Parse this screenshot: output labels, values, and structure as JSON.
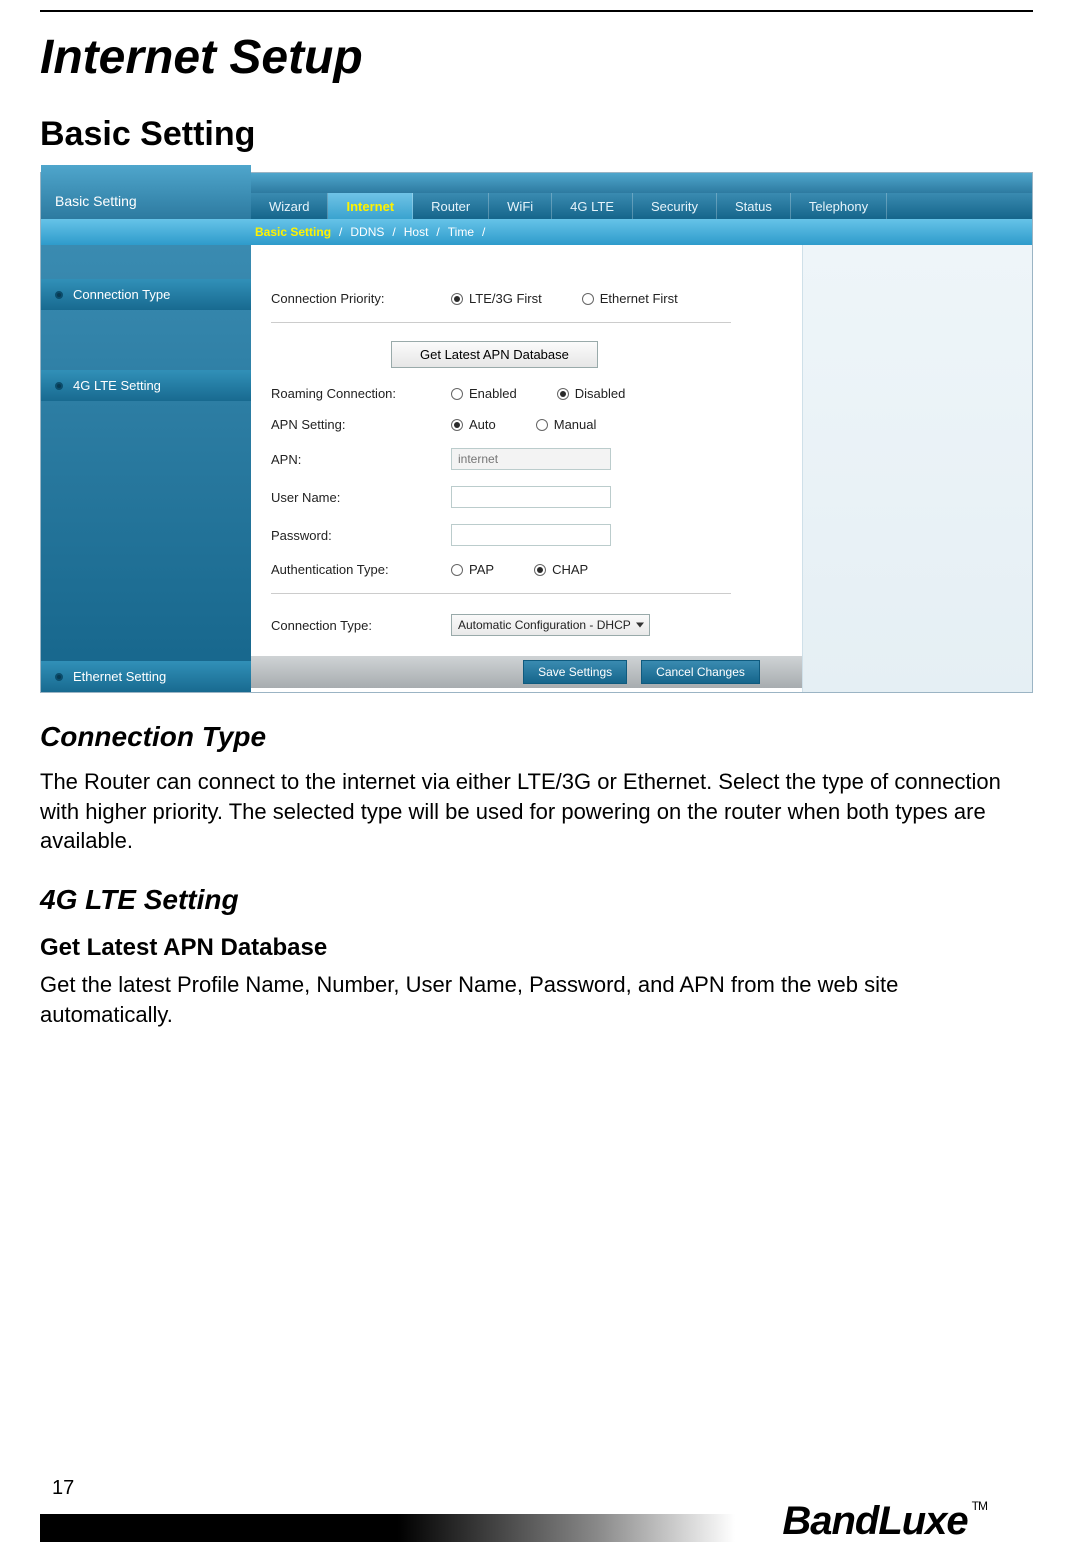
{
  "page": {
    "title": "Internet Setup",
    "section": "Basic Setting",
    "connection_type_heading": "Connection Type",
    "connection_type_body": "The Router can connect to the internet via either LTE/3G or Ethernet. Select the type of connection with higher priority. The selected type will be used for powering on the router when both types are available.",
    "lte_heading": "4G LTE Setting",
    "apn_db_heading": "Get Latest APN Database",
    "apn_db_body": "Get the latest Profile Name, Number, User Name, Password, and APN from the web site automatically.",
    "page_number": "17",
    "brand": "BandLuxe",
    "brand_tm": "TM"
  },
  "screenshot": {
    "sidebar_title": "Basic Setting",
    "tabs": [
      "Wizard",
      "Internet",
      "Router",
      "WiFi",
      "4G LTE",
      "Security",
      "Status",
      "Telephony"
    ],
    "active_tab_index": 1,
    "subnav": [
      "Basic Setting",
      "DDNS",
      "Host",
      "Time"
    ],
    "subnav_active_index": 0,
    "side_items": [
      "Connection Type",
      "4G LTE Setting",
      "Ethernet Setting"
    ],
    "conn_priority_label": "Connection Priority:",
    "conn_priority_opts": [
      "LTE/3G First",
      "Ethernet First"
    ],
    "conn_priority_selected": 0,
    "get_apn_btn": "Get Latest APN Database",
    "roaming_label": "Roaming Connection:",
    "roaming_opts": [
      "Enabled",
      "Disabled"
    ],
    "roaming_selected": 1,
    "apn_setting_label": "APN Setting:",
    "apn_setting_opts": [
      "Auto",
      "Manual"
    ],
    "apn_setting_selected": 0,
    "apn_label": "APN:",
    "apn_placeholder": "internet",
    "username_label": "User Name:",
    "password_label": "Password:",
    "auth_label": "Authentication Type:",
    "auth_opts": [
      "PAP",
      "CHAP"
    ],
    "auth_selected": 1,
    "connection_type_label": "Connection Type:",
    "connection_type_value": "Automatic Configuration - DHCP",
    "save_btn": "Save Settings",
    "cancel_btn": "Cancel Changes"
  }
}
